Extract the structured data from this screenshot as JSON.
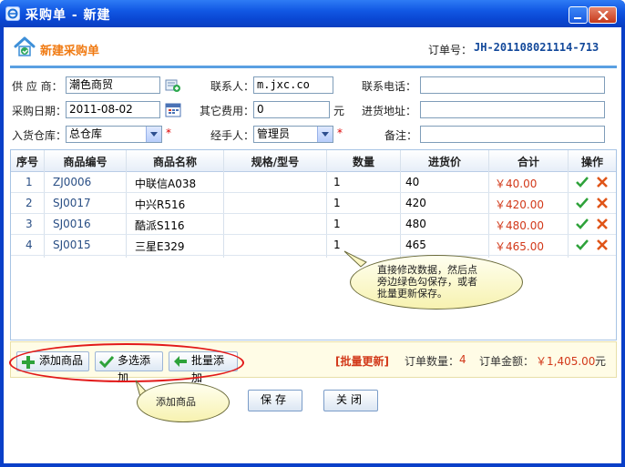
{
  "window": {
    "title": "采购单 - 新建"
  },
  "header": {
    "title": "新建采购单",
    "order_no_label": "订单号：",
    "order_no": "JH-201108021114-713"
  },
  "form": {
    "supplier_label": "供 应 商：",
    "supplier_value": "潮色商贸",
    "contact_label": "联系人：",
    "contact_value": "m.jxc.co",
    "phone_label": "联系电话：",
    "phone_value": "",
    "date_label": "采购日期：",
    "date_value": "2011-08-02",
    "other_cost_label": "其它费用：",
    "other_cost_value": "0",
    "other_cost_unit": "元",
    "address_label": "进货地址：",
    "address_value": "",
    "warehouse_label": "入货仓库：",
    "warehouse_value": "总仓库",
    "handler_label": "经手人：",
    "handler_value": "管理员",
    "remark_label": "备注：",
    "remark_value": "",
    "required_mark": "*"
  },
  "table": {
    "columns": [
      "序号",
      "商品编号",
      "商品名称",
      "规格/型号",
      "数量",
      "进货价",
      "合计",
      "操作"
    ],
    "rows": [
      {
        "no": "1",
        "code": "ZJ0006",
        "name": "中联信A038",
        "spec": "",
        "qty": "1",
        "price": "40",
        "total": "￥40.00"
      },
      {
        "no": "2",
        "code": "SJ0017",
        "name": "中兴R516",
        "spec": "",
        "qty": "1",
        "price": "420",
        "total": "￥420.00"
      },
      {
        "no": "3",
        "code": "SJ0016",
        "name": "酷派S116",
        "spec": "",
        "qty": "1",
        "price": "480",
        "total": "￥480.00"
      },
      {
        "no": "4",
        "code": "SJ0015",
        "name": "三星E329",
        "spec": "",
        "qty": "1",
        "price": "465",
        "total": "￥465.00"
      }
    ]
  },
  "tip_edit": {
    "line1": "直接修改数据，然后点",
    "line2": "旁边绿色勾保存，或者",
    "line3": "批量更新保存。"
  },
  "footer": {
    "add_product": "添加商品",
    "multi_add": "多选添加",
    "batch_add": "批量添加",
    "batch_update": "[批量更新]",
    "qty_label": "订单数量：",
    "qty_value": "4",
    "amount_label": "订单金额：",
    "amount_value": "￥1,405.00",
    "amount_unit": "元"
  },
  "tip_add": {
    "text": "添加商品"
  },
  "actions": {
    "save": "保存",
    "close": "关闭"
  },
  "colors": {
    "accent_orange": "#f07a12",
    "order_blue": "#12489a",
    "title_blue": "#0a47d3",
    "highlight_red": "#d2391a"
  }
}
